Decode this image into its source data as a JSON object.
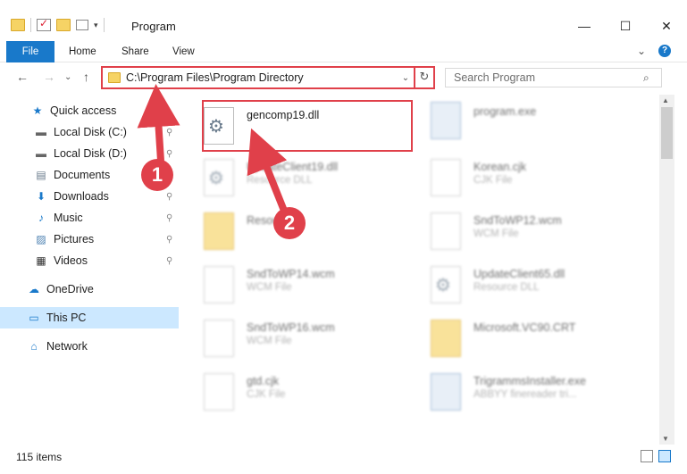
{
  "window": {
    "title": "Program",
    "minimize": "—",
    "maximize": "☐",
    "close": "✕"
  },
  "ribbon": {
    "tabs": [
      "File",
      "Home",
      "Share",
      "View"
    ],
    "expand": "⌄",
    "help": "?"
  },
  "nav": {
    "back": "←",
    "forward": "→",
    "recent": "⌄",
    "up": "↑"
  },
  "address": {
    "path": "C:\\Program Files\\Program Directory",
    "dropdown": "⌄",
    "refresh": "↻"
  },
  "search": {
    "placeholder": "Search Program",
    "icon": "⌕"
  },
  "sidebar": {
    "items": [
      {
        "label": "Quick access",
        "icon": "★"
      },
      {
        "label": "Local Disk (C:)",
        "icon": "▬"
      },
      {
        "label": "Local Disk (D:)",
        "icon": "▬"
      },
      {
        "label": "Documents",
        "icon": "▤"
      },
      {
        "label": "Downloads",
        "icon": "⬇"
      },
      {
        "label": "Music",
        "icon": "♪"
      },
      {
        "label": "Pictures",
        "icon": "▨"
      },
      {
        "label": "Videos",
        "icon": "▦"
      },
      {
        "label": "OneDrive",
        "icon": "☁"
      },
      {
        "label": "This PC",
        "icon": "▭"
      },
      {
        "label": "Network",
        "icon": "⌂"
      }
    ],
    "pin": "📌"
  },
  "files": [
    {
      "name": "gencomp19.dll",
      "type": ""
    },
    {
      "name": "program.exe",
      "type": ""
    },
    {
      "name": "UpdateClient19.dll",
      "type": "Resource DLL"
    },
    {
      "name": "Korean.cjk",
      "type": "CJK File"
    },
    {
      "name": "Resou",
      "type": ""
    },
    {
      "name": "SndToWP12.wcm",
      "type": "WCM File"
    },
    {
      "name": "SndToWP14.wcm",
      "type": "WCM File"
    },
    {
      "name": "UpdateClient65.dll",
      "type": "Resource DLL"
    },
    {
      "name": "SndToWP16.wcm",
      "type": "WCM File"
    },
    {
      "name": "Microsoft.VC90.CRT",
      "type": ""
    },
    {
      "name": "gtd.cjk",
      "type": "CJK File"
    },
    {
      "name": "TrigrammsInstaller.exe",
      "type": "ABBYY finereader tri..."
    }
  ],
  "callouts": [
    "1",
    "2"
  ],
  "status": {
    "items": "115 items"
  },
  "colors": {
    "accent": "#1979ca",
    "highlight": "#e0404a"
  }
}
